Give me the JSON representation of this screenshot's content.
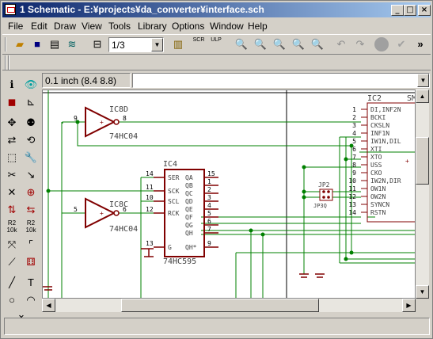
{
  "window": {
    "title": "1 Schematic - E:¥projects¥da_converter¥interface.sch",
    "min_label": "_",
    "max_label": "□",
    "close_label": "×"
  },
  "menu": [
    {
      "id": "file",
      "label": "File"
    },
    {
      "id": "edit",
      "label": "Edit"
    },
    {
      "id": "draw",
      "label": "Draw"
    },
    {
      "id": "view",
      "label": "View"
    },
    {
      "id": "tools",
      "label": "Tools"
    },
    {
      "id": "library",
      "label": "Library"
    },
    {
      "id": "options",
      "label": "Options"
    },
    {
      "id": "window",
      "label": "Window"
    },
    {
      "id": "help",
      "label": "Help"
    }
  ],
  "toolbar": {
    "sheet_select": "1/3",
    "overflow": "»",
    "stop_label": "STOP",
    "scr_label": "SCR",
    "ulp_label": "ULP"
  },
  "cmdbar": {
    "grid_info": "0.1 inch (8.4 8.8)",
    "command_value": ""
  },
  "schematic": {
    "parts": {
      "ic8d": {
        "name": "IC8D",
        "value": "74HC04",
        "pin_in": "9",
        "pin_out": "8"
      },
      "ic8c": {
        "name": "IC8C",
        "value": "74HC04",
        "pin_in": "5",
        "pin_out": "6"
      },
      "ic4": {
        "name": "IC4",
        "value": "74HC595",
        "left_pins": [
          {
            "num": "14",
            "label": "SER"
          },
          {
            "num": "11",
            "label": "SCK"
          },
          {
            "num": "10",
            "label": "SCL"
          },
          {
            "num": "12",
            "label": "RCK"
          },
          {
            "num": "13",
            "label": "G"
          }
        ],
        "right_pins": [
          {
            "num": "15",
            "label": "QA"
          },
          {
            "num": "1",
            "label": "QB"
          },
          {
            "num": "2",
            "label": "QC"
          },
          {
            "num": "3",
            "label": "QD"
          },
          {
            "num": "4",
            "label": "QE"
          },
          {
            "num": "5",
            "label": "QF"
          },
          {
            "num": "6",
            "label": "QG"
          },
          {
            "num": "7",
            "label": "QH"
          },
          {
            "num": "9",
            "label": "QH*"
          }
        ]
      },
      "ic2": {
        "name": "IC2",
        "value": "SM",
        "pins": [
          {
            "num": "1",
            "label": "DI,INF2N"
          },
          {
            "num": "2",
            "label": "BCKI"
          },
          {
            "num": "3",
            "label": "CKSLN"
          },
          {
            "num": "4",
            "label": "INF1N"
          },
          {
            "num": "5",
            "label": "IW1N,DIL"
          },
          {
            "num": "6",
            "label": "XTI"
          },
          {
            "num": "7",
            "label": "XTO"
          },
          {
            "num": "8",
            "label": "USS"
          },
          {
            "num": "9",
            "label": "CKO"
          },
          {
            "num": "10",
            "label": "IW2N,DIR"
          },
          {
            "num": "11",
            "label": "OW1N"
          },
          {
            "num": "12",
            "label": "OW2N"
          },
          {
            "num": "13",
            "label": "SYNCN"
          },
          {
            "num": "14",
            "label": "RSTN"
          }
        ]
      },
      "jp2": {
        "name": "JP2",
        "value": "JP3Q"
      }
    }
  },
  "colors": {
    "wire": "#008000",
    "part": "#800000",
    "text": "#404040",
    "ground": "#800000",
    "frame": "#000000",
    "pin_num": "#000000"
  }
}
